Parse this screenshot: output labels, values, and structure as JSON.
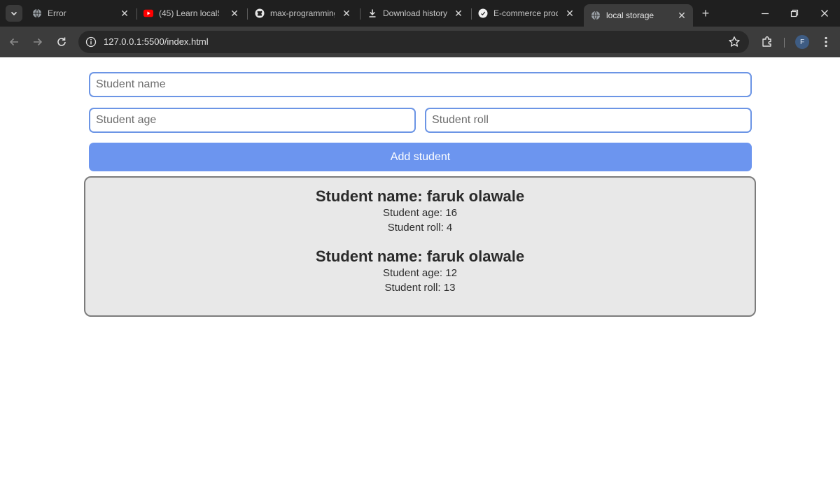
{
  "browser": {
    "tabs": [
      {
        "title": "Error",
        "icon": "globe-icon"
      },
      {
        "title": "(45) Learn localSto",
        "icon": "youtube-icon"
      },
      {
        "title": "max-programming",
        "icon": "github-icon"
      },
      {
        "title": "Download history",
        "icon": "download-icon"
      },
      {
        "title": "E-commerce prod",
        "icon": "site-icon"
      },
      {
        "title": "local storage",
        "icon": "globe-icon",
        "active": true
      }
    ],
    "new_tab": "+",
    "url": "127.0.0.1:5500/index.html",
    "profile_initial": "F"
  },
  "form": {
    "name_placeholder": "Student name",
    "age_placeholder": "Student age",
    "roll_placeholder": "Student roll",
    "add_button": "Add student"
  },
  "students": [
    {
      "name": "Student name: faruk olawale",
      "age": "Student age: 16",
      "roll": "Student roll: 4"
    },
    {
      "name": "Student name: faruk olawale",
      "age": "Student age: 12",
      "roll": "Student roll: 13"
    }
  ],
  "colors": {
    "accent": "#6c95ef",
    "input_border": "#6c95e5",
    "list_bg": "#e8e8e8",
    "chrome_dark": "#1f1f1f",
    "chrome_toolbar": "#3c3c3c"
  }
}
